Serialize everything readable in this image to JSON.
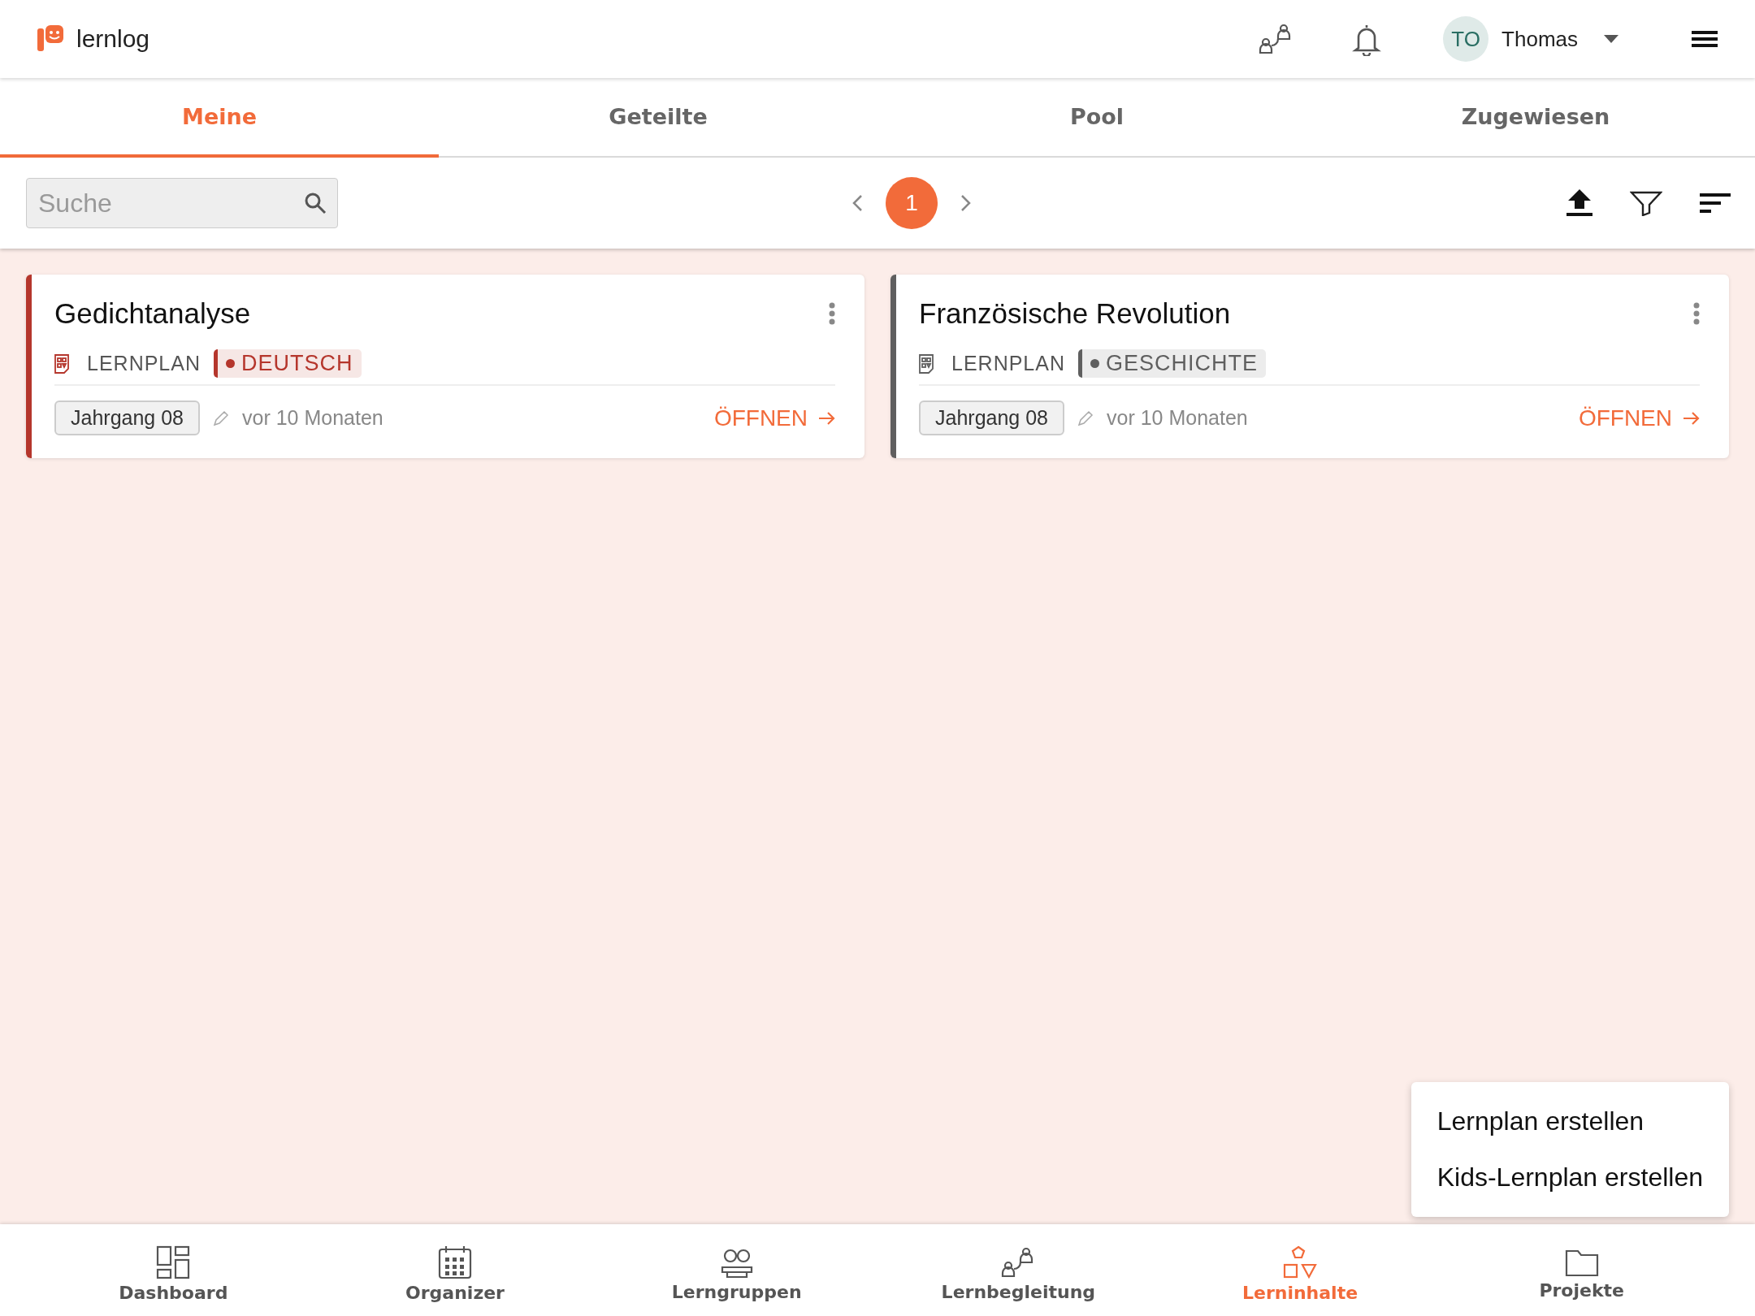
{
  "header": {
    "logo": "lernlog",
    "user": {
      "initials": "TO",
      "name": "Thomas"
    }
  },
  "tabs": [
    {
      "label": "Meine",
      "selected": true
    },
    {
      "label": "Geteilte",
      "selected": false
    },
    {
      "label": "Pool",
      "selected": false
    },
    {
      "label": "Zugewiesen",
      "selected": false
    }
  ],
  "toolbar": {
    "search": {
      "placeholder": "Suche"
    },
    "pages": [
      {
        "label": "1",
        "selected": true
      }
    ]
  },
  "cards": [
    {
      "title": "Gedichtanalyse",
      "type": "LERNPLAN",
      "subject": "DEUTSCH",
      "color": "#b5362c",
      "grade": "Jahrgang 08",
      "edited": "vor 10 Monaten",
      "action": "ÖFFNEN"
    },
    {
      "title": "Französische Revolution",
      "type": "LERNPLAN",
      "subject": "GESCHICHTE",
      "color": "#5f5f5f",
      "grade": "Jahrgang 08",
      "edited": "vor 10 Monaten",
      "action": "ÖFFNEN"
    }
  ],
  "bottom_nav": [
    {
      "kind": "dashboard",
      "label": "Dashboard",
      "selected": false
    },
    {
      "kind": "organizer",
      "label": "Organizer",
      "selected": false
    },
    {
      "kind": "groups",
      "label": "Lerngruppen",
      "selected": false
    },
    {
      "kind": "mentoring",
      "label": "Lernbegleitung",
      "selected": false
    },
    {
      "kind": "content",
      "label": "Lerninhalte",
      "selected": true
    },
    {
      "kind": "projects",
      "label": "Projekte",
      "selected": false
    }
  ],
  "menu": {
    "items": [
      "Lernplan erstellen",
      "Kids-Lernplan erstellen"
    ]
  }
}
